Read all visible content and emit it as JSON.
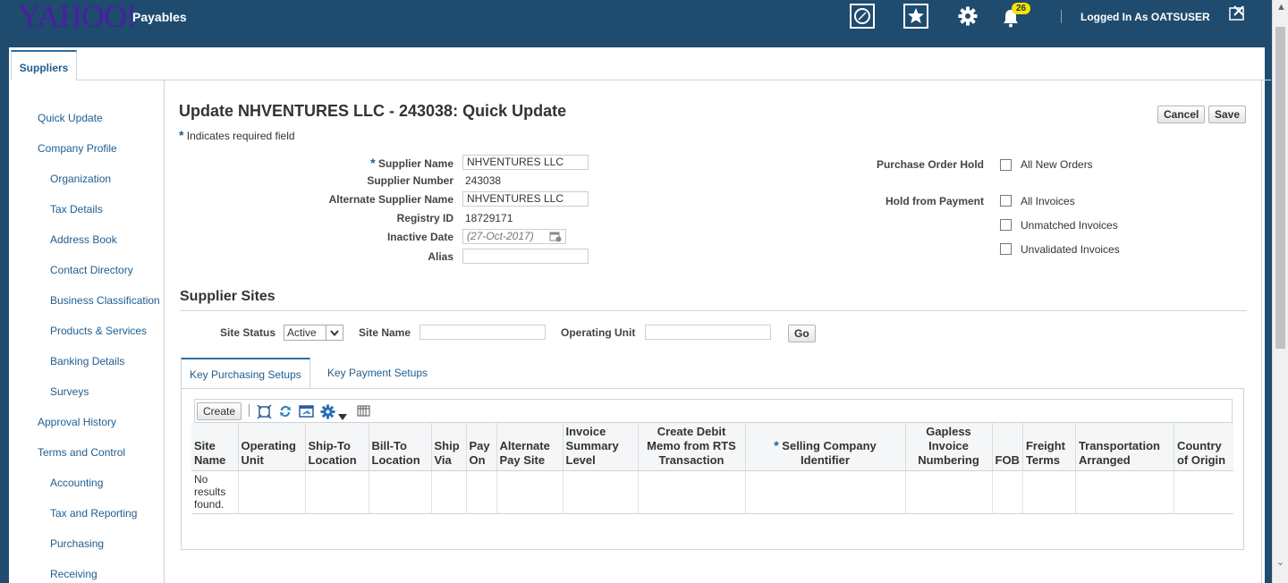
{
  "header": {
    "logo": "YAHOO!",
    "app_name": "Payables",
    "notification_count": "26",
    "logged_in_prefix": "Logged In As",
    "user": "OATSUSER"
  },
  "tabs": {
    "suppliers": "Suppliers"
  },
  "sidebar": {
    "items": [
      {
        "label": "Quick Update"
      },
      {
        "label": "Company Profile"
      },
      {
        "label": "Organization"
      },
      {
        "label": "Tax Details"
      },
      {
        "label": "Address Book"
      },
      {
        "label": "Contact Directory"
      },
      {
        "label": "Business Classification"
      },
      {
        "label": "Products & Services"
      },
      {
        "label": "Banking Details"
      },
      {
        "label": "Surveys"
      },
      {
        "label": "Approval History"
      },
      {
        "label": "Terms and Control"
      },
      {
        "label": "Accounting"
      },
      {
        "label": "Tax and Reporting"
      },
      {
        "label": "Purchasing"
      },
      {
        "label": "Receiving"
      }
    ]
  },
  "page": {
    "title": "Update NHVENTURES LLC - 243038: Quick Update",
    "required_note": "Indicates required field",
    "cancel_label": "Cancel",
    "save_label": "Save"
  },
  "form": {
    "supplier_name_label": "Supplier Name",
    "supplier_name_value": "NHVENTURES LLC",
    "supplier_number_label": "Supplier Number",
    "supplier_number_value": "243038",
    "alternate_name_label": "Alternate Supplier Name",
    "alternate_name_value": "NHVENTURES LLC",
    "registry_id_label": "Registry ID",
    "registry_id_value": "18729171",
    "inactive_date_label": "Inactive Date",
    "inactive_date_placeholder": "(27-Oct-2017)",
    "alias_label": "Alias",
    "alias_value": "",
    "po_hold_label": "Purchase Order Hold",
    "all_new_orders": "All New Orders",
    "hold_payment_label": "Hold from Payment",
    "all_invoices": "All Invoices",
    "unmatched_invoices": "Unmatched Invoices",
    "unvalidated_invoices": "Unvalidated Invoices"
  },
  "sites": {
    "title": "Supplier Sites",
    "site_status_label": "Site Status",
    "site_status_value": "Active",
    "site_name_label": "Site Name",
    "operating_unit_label": "Operating Unit",
    "go_label": "Go",
    "tab_purchasing": "Key Purchasing Setups",
    "tab_payment": "Key Payment Setups",
    "create_label": "Create",
    "columns": [
      "Site Name",
      "Operating Unit",
      "Ship-To Location",
      "Bill-To Location",
      "Ship Via",
      "Pay On",
      "Alternate Pay Site",
      "Invoice Summary Level",
      "Create Debit Memo from RTS Transaction",
      "Selling Company Identifier",
      "Gapless Invoice Numbering",
      "FOB",
      "Freight Terms",
      "Transportation Arranged",
      "Country of Origin"
    ],
    "empty_message": "No results found."
  },
  "colors": {
    "header_bg": "#1f4b6e",
    "link": "#1f5d8e",
    "badge": "#f5e500"
  }
}
